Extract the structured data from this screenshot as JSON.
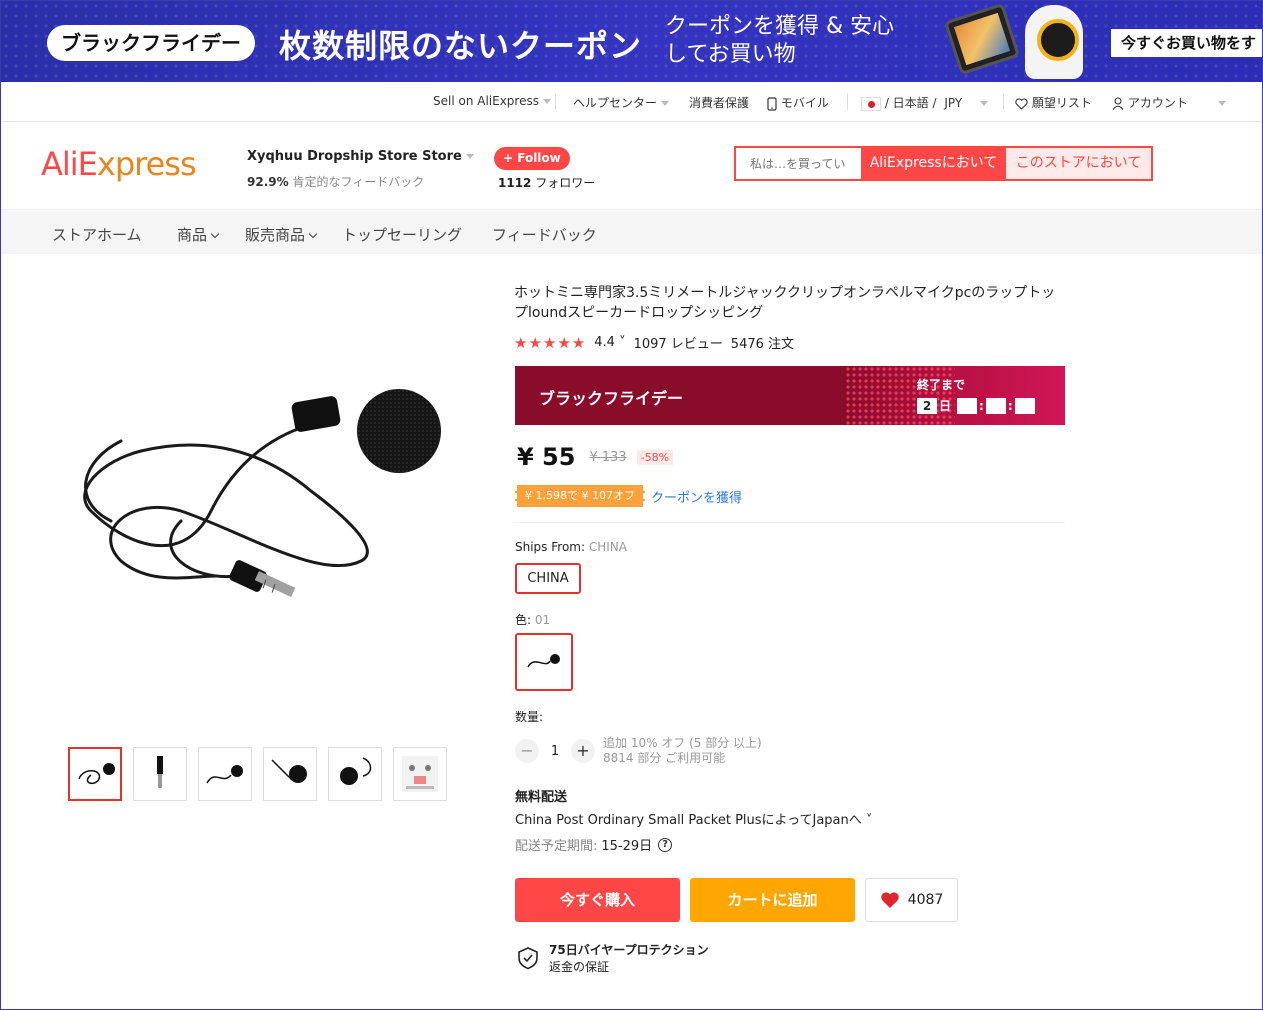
{
  "banner": {
    "pill": "ブラックフライデー",
    "headline": "枚数制限のないクーポン",
    "sub": "クーポンを獲得 & 安心してお買い物",
    "cta": "今すぐお買い物をす"
  },
  "topnav": {
    "sell": "Sell on AliExpress",
    "help": "ヘルプセンター",
    "protection": "消費者保護",
    "mobile": "モバイル",
    "lang": "/ 日本語 /",
    "currency": "JPY",
    "wishlist": "願望リスト",
    "account": "アカウント"
  },
  "header": {
    "logo_a": "AliE",
    "logo_b": "xpress",
    "store_name": "Xyqhuu Dropship Store Store",
    "feedback_pct": "92.9%",
    "feedback_label": "肯定的なフィードバック",
    "follow": "+ Follow",
    "followers_count": "1112",
    "followers_label": "フォロワー"
  },
  "search": {
    "placeholder": "私は…を買ってい",
    "btn_all": "AliExpressにおいて",
    "btn_store": "このストアにおいて"
  },
  "storenav": {
    "home": "ストアホーム",
    "products": "商品",
    "sale": "販売商品",
    "top": "トップセーリング",
    "feedback": "フィードバック"
  },
  "product": {
    "title": "ホットミニ専門家3.5ミリメートルジャッククリップオンラペルマイクpcのラップトップloundスピーカードロップシッピング",
    "stars": "★★★★★",
    "rating": "4.4",
    "reviews": "1097 レビュー",
    "orders": "5476 注文",
    "rating_value": 4.4
  },
  "promo": {
    "label": "ブラックフライデー",
    "ends": "終了まで",
    "days": "2",
    "day_unit": "日"
  },
  "price": {
    "current": "¥ 55",
    "original": "¥ 133",
    "discount": "-58%",
    "coupon": "¥ 1,598で ¥ 107オフ",
    "coupon_link": "クーポンを獲得"
  },
  "options": {
    "ships_label": "Ships From:",
    "ships_value": "CHINA",
    "ships_option": "CHINA",
    "color_label": "色:",
    "color_value": "01"
  },
  "quantity": {
    "label": "数量:",
    "minus": "−",
    "value": "1",
    "plus": "+",
    "note1": "追加 10% オフ (5 部分 以上)",
    "note2": "8814 部分 ご利用可能"
  },
  "shipping": {
    "title": "無料配送",
    "method": "China Post Ordinary Small Packet PlusによってJapanへ ˅",
    "eta_label": "配送予定期間:",
    "eta_value": "15-29日",
    "help": "?"
  },
  "actions": {
    "buy": "今すぐ購入",
    "cart": "カートに追加",
    "wish_count": "4087"
  },
  "protection": {
    "title": "75日バイヤープロテクション",
    "sub": "返金の保証"
  },
  "colors": {
    "accent": "#ff4747",
    "orange": "#ffa600",
    "banner": "#3434c0",
    "promo": "#8a0c2b"
  }
}
